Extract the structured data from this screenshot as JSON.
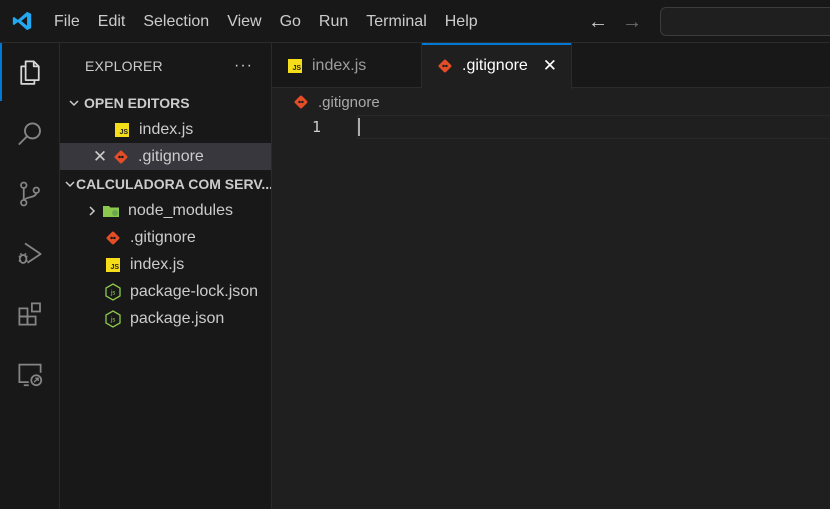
{
  "menu": [
    "File",
    "Edit",
    "Selection",
    "View",
    "Go",
    "Run",
    "Terminal",
    "Help"
  ],
  "nav": {
    "back": "←",
    "forward": "→"
  },
  "activity": [
    "explorer-icon",
    "search-icon",
    "source-control-icon",
    "run-debug-icon",
    "extensions-icon",
    "remote-explorer-icon"
  ],
  "sidebar": {
    "title": "EXPLORER",
    "more": "···",
    "open_editors": {
      "title": "OPEN EDITORS",
      "items": [
        {
          "label": "index.js",
          "icon": "js-file-icon"
        },
        {
          "label": ".gitignore",
          "icon": "git-icon",
          "close": "✕"
        }
      ]
    },
    "project": {
      "title": "CALCULADORA COM SERV...",
      "items": [
        {
          "label": "node_modules",
          "icon": "folder-icon"
        },
        {
          "label": ".gitignore",
          "icon": "git-icon"
        },
        {
          "label": "index.js",
          "icon": "js-file-icon"
        },
        {
          "label": "package-lock.json",
          "icon": "node-json-icon"
        },
        {
          "label": "package.json",
          "icon": "node-json-icon"
        }
      ]
    }
  },
  "editor": {
    "tabs": [
      {
        "label": "index.js",
        "active": false
      },
      {
        "label": ".gitignore",
        "active": true,
        "close": "✕"
      }
    ],
    "breadcrumb": ".gitignore",
    "line_number": "1"
  },
  "colors": {
    "accent": "#0078d4",
    "git": "#e44d26",
    "js": "#f5de19",
    "node": "#8cc84b",
    "vscode_blue": "#23a9f2"
  }
}
